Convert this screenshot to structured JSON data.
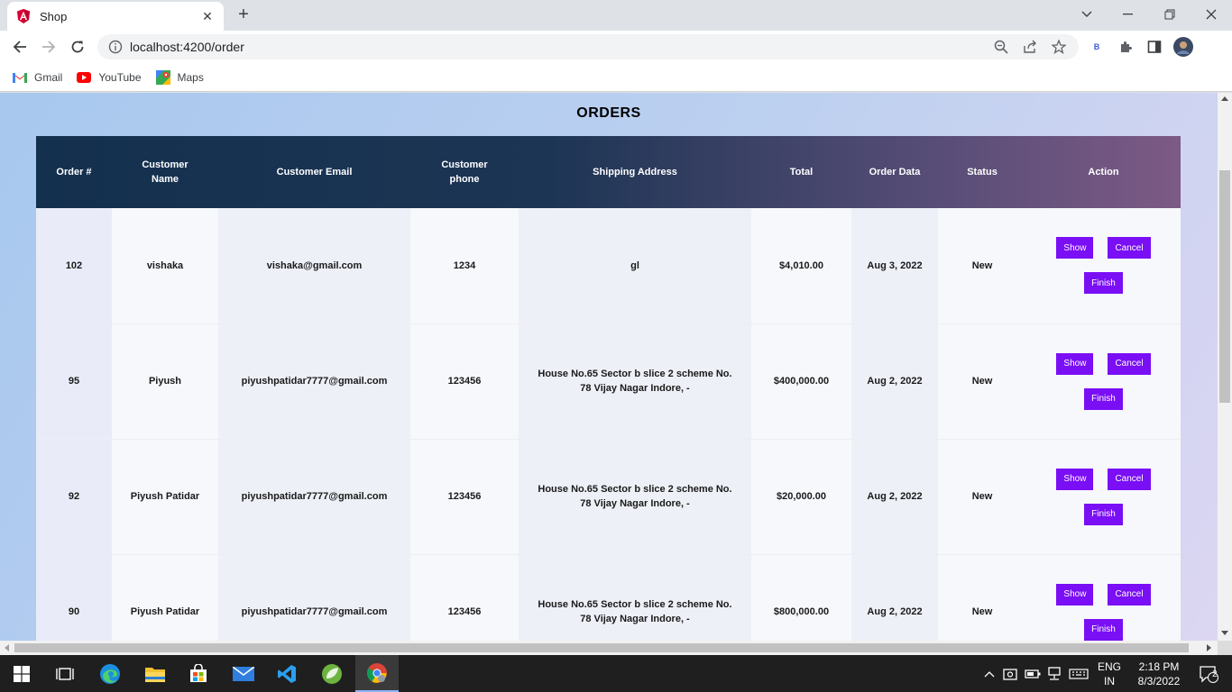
{
  "browser": {
    "tab_title": "Shop",
    "url": "localhost:4200/order",
    "bookmarks": [
      {
        "label": "Gmail",
        "icon": "gmail-icon"
      },
      {
        "label": "YouTube",
        "icon": "youtube-icon"
      },
      {
        "label": "Maps",
        "icon": "maps-icon"
      }
    ],
    "extension_label": "B"
  },
  "page": {
    "title": "ORDERS",
    "columns": [
      "Order #",
      "Customer Name",
      "Customer Email",
      "Customer phone",
      "Shipping Address",
      "Total",
      "Order Data",
      "Status",
      "Action"
    ],
    "rows": [
      {
        "id": "102",
        "name": "vishaka",
        "email": "vishaka@gmail.com",
        "phone": "1234",
        "address": "gl",
        "total": "$4,010.00",
        "date": "Aug 3, 2022",
        "status": "New"
      },
      {
        "id": "95",
        "name": "Piyush",
        "email": "piyushpatidar7777@gmail.com",
        "phone": "123456",
        "address": "House No.65 Sector b slice 2 scheme No. 78 Vijay Nagar Indore, -",
        "total": "$400,000.00",
        "date": "Aug 2, 2022",
        "status": "New"
      },
      {
        "id": "92",
        "name": "Piyush Patidar",
        "email": "piyushpatidar7777@gmail.com",
        "phone": "123456",
        "address": "House No.65 Sector b slice 2 scheme No. 78 Vijay Nagar Indore, -",
        "total": "$20,000.00",
        "date": "Aug 2, 2022",
        "status": "New"
      },
      {
        "id": "90",
        "name": "Piyush Patidar",
        "email": "piyushpatidar7777@gmail.com",
        "phone": "123456",
        "address": "House No.65 Sector b slice 2 scheme No. 78 Vijay Nagar Indore, -",
        "total": "$800,000.00",
        "date": "Aug 2, 2022",
        "status": "New"
      }
    ],
    "actions": {
      "show": "Show",
      "cancel": "Cancel",
      "finish": "Finish"
    },
    "colors": {
      "button": "#7a0ef5",
      "header_start": "#13304e",
      "header_end": "#7c5a85"
    }
  },
  "taskbar": {
    "lang_top": "ENG",
    "lang_bottom": "IN",
    "time": "2:18 PM",
    "date": "8/3/2022",
    "notifications": "2"
  }
}
